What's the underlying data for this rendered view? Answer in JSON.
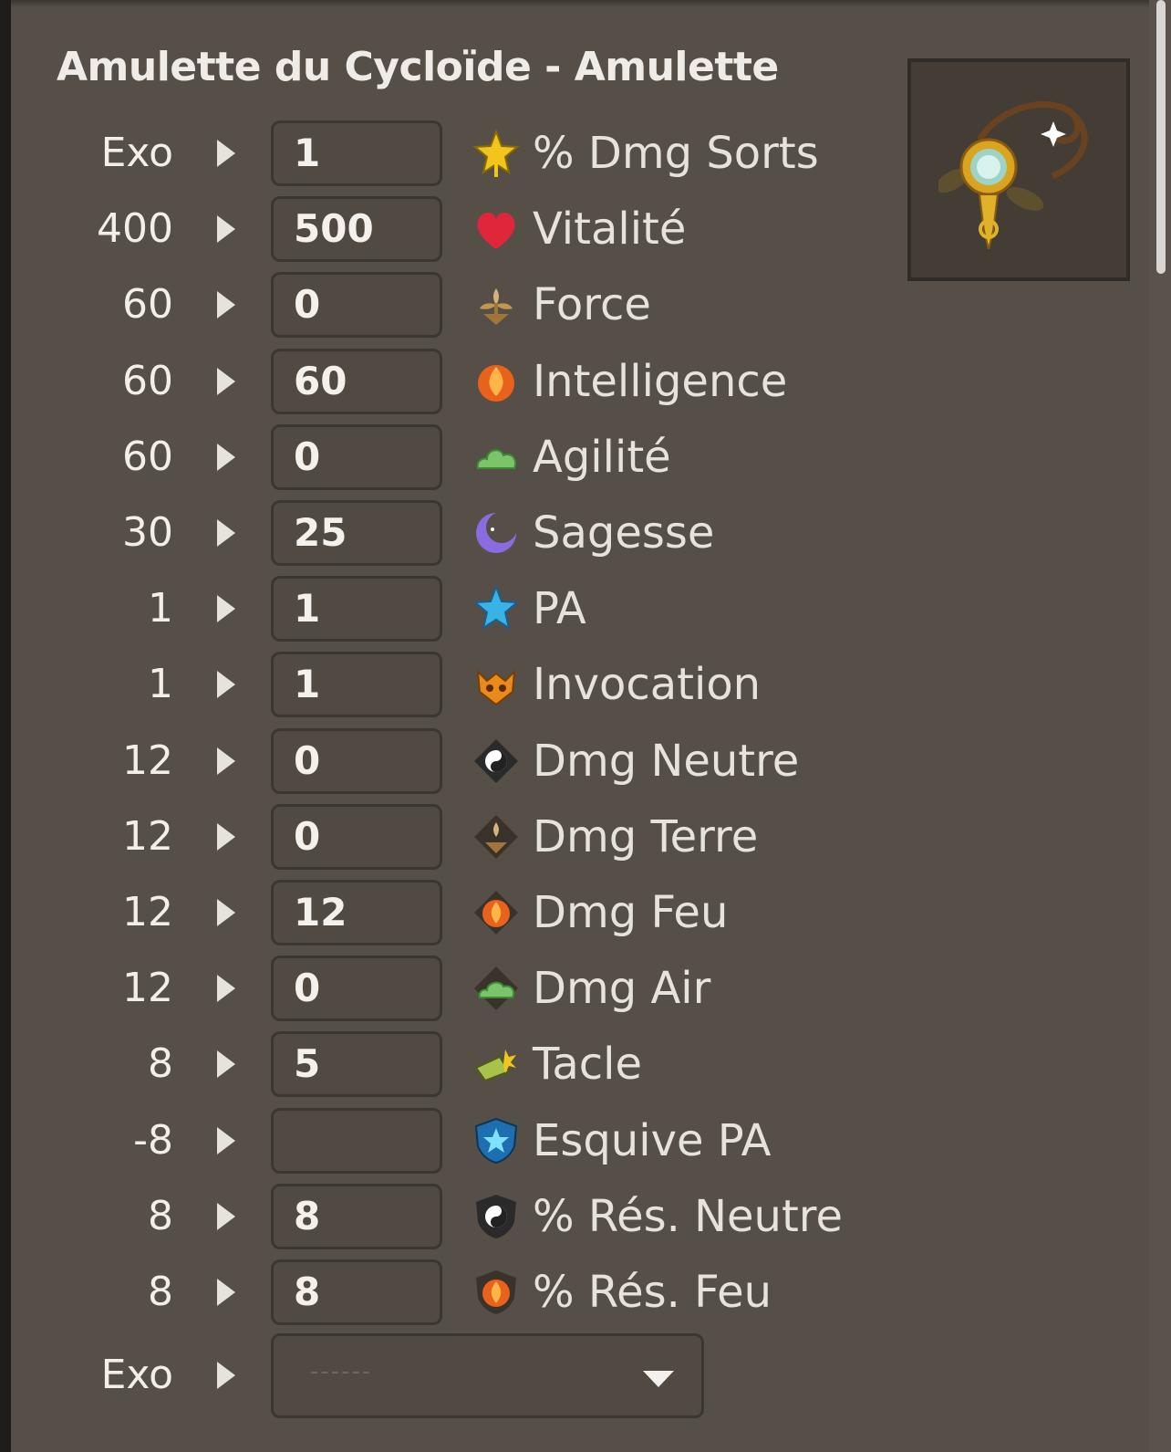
{
  "title": "Amulette du Cycloïde - Amulette",
  "stats": [
    {
      "base": "Exo",
      "value": "1",
      "label": "% Dmg Sorts",
      "icon": "gold-star-icon"
    },
    {
      "base": "400",
      "value": "500",
      "label": "Vitalité",
      "icon": "heart-icon"
    },
    {
      "base": "60",
      "value": "0",
      "label": "Force",
      "icon": "earth-plant-icon"
    },
    {
      "base": "60",
      "value": "60",
      "label": "Intelligence",
      "icon": "fire-icon"
    },
    {
      "base": "60",
      "value": "0",
      "label": "Agilité",
      "icon": "air-cloud-icon"
    },
    {
      "base": "30",
      "value": "25",
      "label": "Sagesse",
      "icon": "moon-icon"
    },
    {
      "base": "1",
      "value": "1",
      "label": "PA",
      "icon": "blue-star-icon"
    },
    {
      "base": "1",
      "value": "1",
      "label": "Invocation",
      "icon": "summon-mask-icon"
    },
    {
      "base": "12",
      "value": "0",
      "label": "Dmg Neutre",
      "icon": "neutral-yinyang-icon"
    },
    {
      "base": "12",
      "value": "0",
      "label": "Dmg Terre",
      "icon": "earth-damage-icon"
    },
    {
      "base": "12",
      "value": "12",
      "label": "Dmg Feu",
      "icon": "fire-damage-icon"
    },
    {
      "base": "12",
      "value": "0",
      "label": "Dmg Air",
      "icon": "air-damage-icon"
    },
    {
      "base": "8",
      "value": "5",
      "label": "Tacle",
      "icon": "lock-tackle-icon"
    },
    {
      "base": "-8",
      "value": "",
      "label": "Esquive PA",
      "icon": "ap-dodge-shield-icon"
    },
    {
      "base": "8",
      "value": "8",
      "label": "% Rés. Neutre",
      "icon": "neutral-resistance-icon"
    },
    {
      "base": "8",
      "value": "8",
      "label": "% Rés. Feu",
      "icon": "fire-resistance-icon"
    }
  ],
  "exo_select": {
    "base": "Exo",
    "value": "------"
  },
  "colors": {
    "background": "#564f47",
    "field": "#514a42",
    "field_border": "#3b3630"
  }
}
